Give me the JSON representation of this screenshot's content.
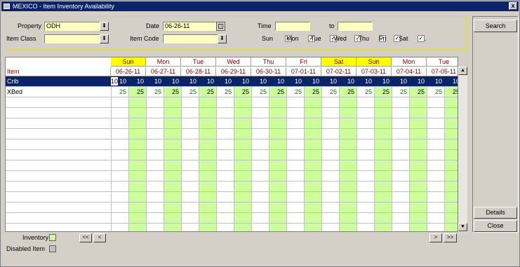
{
  "window": {
    "title": "MEXICO - Item Inventory Availability",
    "close_label": "x"
  },
  "filters": {
    "property_label": "Property",
    "property_value": "ODH",
    "date_label": "Date",
    "date_value": "06-26-11",
    "time_label": "Time",
    "time_value": "",
    "to_label": "to",
    "to_value": "",
    "item_class_label": "Item Class",
    "item_class_value": "",
    "item_code_label": "Item Code",
    "item_code_value": "",
    "days": [
      {
        "label": "Sun",
        "checked": true
      },
      {
        "label": "Mon",
        "checked": true
      },
      {
        "label": ".Tue",
        "checked": true
      },
      {
        "label": ".Wed",
        "checked": true
      },
      {
        "label": ".Thu",
        "checked": true
      },
      {
        "label": "Fri",
        "checked": true
      },
      {
        "label": "Sat",
        "checked": true
      }
    ],
    "trailing_dot": ".",
    "dropdown_glyph": "⬇"
  },
  "buttons": {
    "search": "Search",
    "details": "Details",
    "close": "Close",
    "first": "<<",
    "prev": "<",
    "next": ">",
    "last": ">>"
  },
  "grid": {
    "item_header": "Item",
    "columns": [
      {
        "day": "Sun",
        "date": "06-26-11",
        "weekend": true
      },
      {
        "day": "Mon",
        "date": "06-27-11",
        "weekend": false
      },
      {
        "day": "Tue",
        "date": "06-28-11",
        "weekend": false
      },
      {
        "day": "Wed",
        "date": "06-29-11",
        "weekend": false
      },
      {
        "day": "Thu",
        "date": "06-30-11",
        "weekend": false
      },
      {
        "day": "Fri",
        "date": "07-01-11",
        "weekend": false
      },
      {
        "day": "Sat",
        "date": "07-02-11",
        "weekend": true
      },
      {
        "day": "Sun",
        "date": "07-03-11",
        "weekend": true
      },
      {
        "day": "Mon",
        "date": "07-04-11",
        "weekend": false
      },
      {
        "day": "Tue",
        "date": "07-05-11",
        "weekend": false
      }
    ],
    "rows": [
      {
        "name": "Crib",
        "selected": true,
        "values": [
          "10",
          "10",
          "10",
          "10",
          "10",
          "10",
          "10",
          "10",
          "10",
          "10",
          "10",
          "10",
          "10",
          "10",
          "10",
          "10",
          "10",
          "10",
          "10",
          "10"
        ]
      },
      {
        "name": "XBed",
        "selected": false,
        "values": [
          "25",
          "25",
          "25",
          "25",
          "25",
          "25",
          "25",
          "25",
          "25",
          "25",
          "25",
          "25",
          "25",
          "25",
          "25",
          "25",
          "25",
          "25",
          "25",
          "25"
        ]
      }
    ],
    "empty_rows": 13
  },
  "legend": {
    "inventory_label": "Inventory",
    "inventory_color": "#ccff99",
    "disabled_label": "Disabled Item",
    "disabled_color": "#c0c0c0"
  },
  "scroll": {
    "up": "▲",
    "down": "▼"
  }
}
